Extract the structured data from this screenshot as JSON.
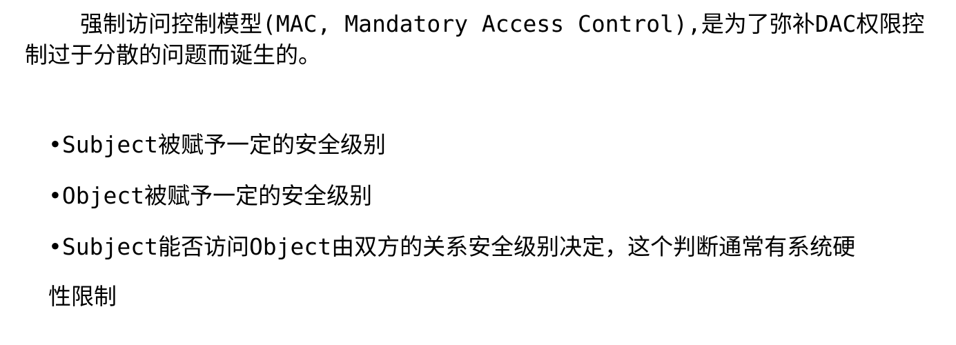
{
  "intro": {
    "text": "强制访问控制模型(MAC, Mandatory Access Control),是为了弥补DAC权限控制过于分散的问题而诞生的。"
  },
  "bullets": [
    {
      "text": "•Subject被赋予一定的安全级别"
    },
    {
      "text": "•Object被赋予一定的安全级别"
    },
    {
      "text": "•Subject能否访问Object由双方的关系安全级别决定，这个判断通常有系统硬性限制"
    }
  ]
}
